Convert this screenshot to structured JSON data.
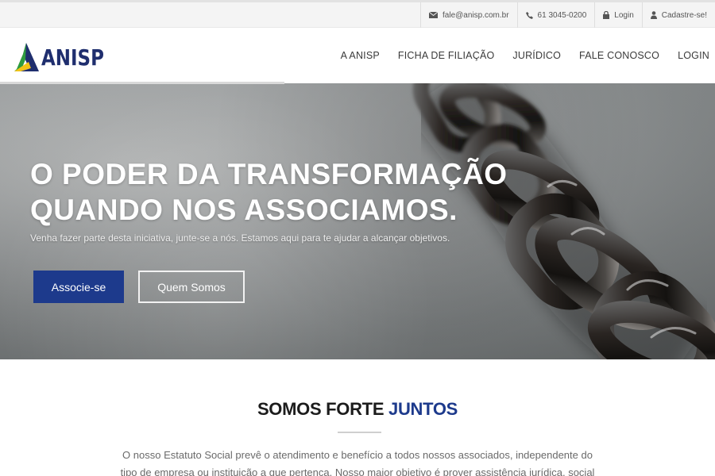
{
  "topbar": {
    "email": "fale@anisp.com.br",
    "phone": "61 3045-0200",
    "login": "Login",
    "signup": "Cadastre-se!"
  },
  "header": {
    "logo_text": "ANISP",
    "nav": [
      "A ANISP",
      "FICHA DE FILIAÇÃO",
      "JURÍDICO",
      "FALE CONOSCO",
      "LOGIN"
    ]
  },
  "hero": {
    "title_line1": "O PODER DA TRANSFORMAÇÃO",
    "title_line2": "QUANDO NOS ASSOCIAMOS.",
    "subtitle": "Venha fazer parte desta iniciativa, junte-se a nós. Estamos aqui para te ajudar a alcançar objetivos.",
    "primary_button": "Associe-se",
    "secondary_button": "Quem Somos"
  },
  "section": {
    "title_part1": "SOMOS FORTE ",
    "title_part2": "JUNTOS",
    "line1": "O nosso Estatuto Social prevê o atendimento e benefício a todos nossos associados, independente do",
    "line2": "tipo de empresa ou instituição a que pertença. Nosso maior objetivo é prover assistência jurídica, social"
  },
  "colors": {
    "brand_blue": "#1d3a8c",
    "logo_green": "#2e9b3e",
    "logo_yellow": "#f2c316"
  }
}
